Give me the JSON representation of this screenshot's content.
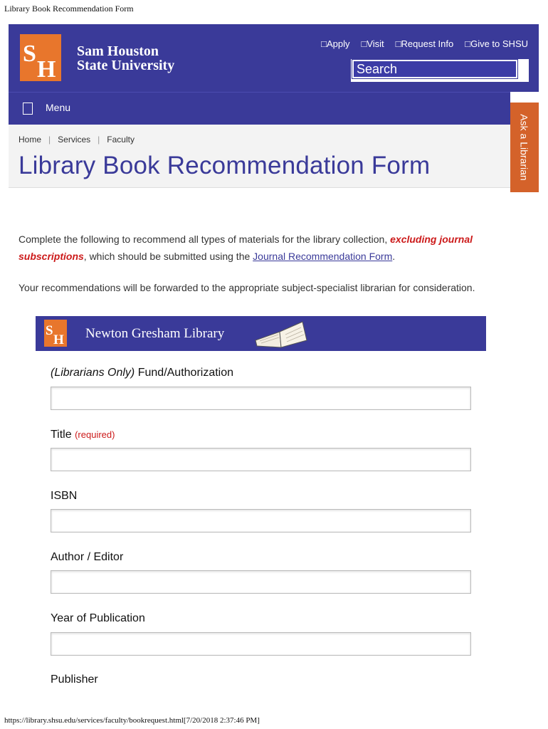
{
  "print": {
    "header": "Library Book Recommendation Form",
    "footer": "https://library.shsu.edu/services/faculty/bookrequest.html[7/20/2018 2:37:46 PM]"
  },
  "brand": {
    "name_line1": "Sam Houston",
    "name_line2": "State University",
    "logo_letters": "SH",
    "colors": {
      "primary": "#3a3a99",
      "accent": "#e8762c",
      "ask_tab": "#d4622a",
      "alert": "#cc1a1a"
    }
  },
  "utility_links": [
    "□Apply",
    "□Visit",
    "□Request Info",
    "□Give to SHSU"
  ],
  "search": {
    "placeholder": "Search"
  },
  "menu": {
    "label": "Menu",
    "icon": "menu-icon"
  },
  "ask_tab": {
    "label": "Ask a Librarian"
  },
  "breadcrumb": [
    "Home",
    "Services",
    "Faculty"
  ],
  "page_title": "Library Book Recommendation Form",
  "intro": {
    "p1_start": "Complete the following to recommend all types of materials for the library collection,",
    "p1_emphasis": "excluding journal subscriptions",
    "p1_mid": ", which should be submitted using the",
    "p1_link": "Journal Recommendation Form",
    "p1_end": ".",
    "p2": "Your recommendations will be forwarded to the appropriate subject-specialist librarian for consideration."
  },
  "library_banner": {
    "name": "Newton Gresham Library",
    "logo_letters": "SH",
    "icon": "open-book-icon"
  },
  "form": {
    "fields": [
      {
        "prefix": "(Librarians Only)",
        "label": "Fund/Authorization",
        "value": ""
      },
      {
        "label": "Title",
        "required": "(required)",
        "value": ""
      },
      {
        "label": "ISBN",
        "value": ""
      },
      {
        "label": "Author / Editor",
        "value": ""
      },
      {
        "label": "Year of Publication",
        "value": ""
      },
      {
        "label": "Publisher"
      }
    ]
  }
}
